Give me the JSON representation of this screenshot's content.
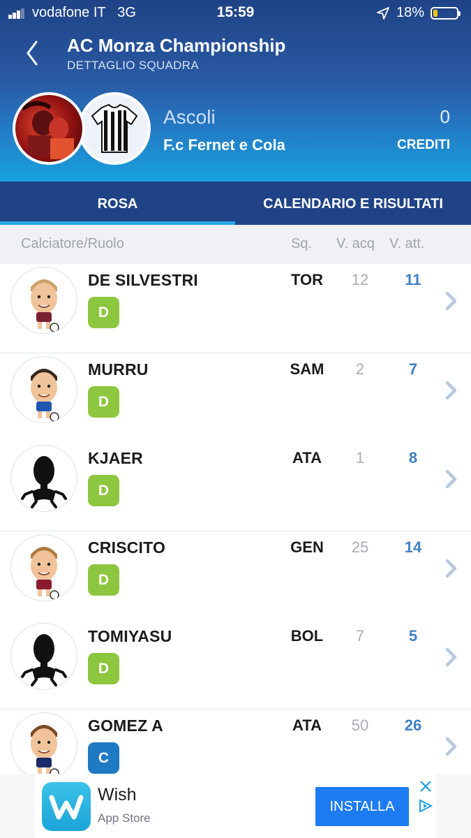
{
  "status_bar": {
    "carrier": "vodafone IT",
    "network": "3G",
    "time": "15:59",
    "battery_percent": "18%",
    "battery_level": 0.18,
    "signal_bars": 3
  },
  "header": {
    "title": "AC Monza Championship",
    "subtitle": "DETTAGLIO SQUADRA"
  },
  "team": {
    "name": "Ascoli",
    "manager": "F.c Fernet e Cola",
    "credits_value": "0",
    "credits_label": "CREDITI"
  },
  "tabs": [
    {
      "label": "ROSA",
      "active": true
    },
    {
      "label": "CALENDARIO E RISULTATI",
      "active": false
    }
  ],
  "columns": {
    "player_role": "Calciatore/Ruolo",
    "team": "Sq.",
    "value_bought": "V. acq",
    "value_current": "V. att."
  },
  "players": [
    {
      "name": "DE SILVESTRI",
      "role": "D",
      "team": "TOR",
      "v_acq": "12",
      "v_att": "11",
      "avatar": "cartoon-player",
      "hair": "#c9a36a",
      "kit": "#7a2231"
    },
    {
      "name": "MURRU",
      "role": "D",
      "team": "SAM",
      "v_acq": "2",
      "v_att": "7",
      "avatar": "cartoon-player",
      "hair": "#3a2a1e",
      "kit": "#1f56b0"
    },
    {
      "name": "KJAER",
      "role": "D",
      "team": "ATA",
      "v_acq": "1",
      "v_att": "8",
      "avatar": "silhouette"
    },
    {
      "name": "CRISCITO",
      "role": "D",
      "team": "GEN",
      "v_acq": "25",
      "v_att": "14",
      "avatar": "cartoon-player",
      "hair": "#b07a3c",
      "kit": "#8a1b2f"
    },
    {
      "name": "TOMIYASU",
      "role": "D",
      "team": "BOL",
      "v_acq": "7",
      "v_att": "5",
      "avatar": "silhouette"
    },
    {
      "name": "GOMEZ A",
      "role": "C",
      "team": "ATA",
      "v_acq": "50",
      "v_att": "26",
      "avatar": "cartoon-player",
      "hair": "#7a4a22",
      "kit": "#1a2a6a"
    }
  ],
  "role_colors": {
    "D": "#8dc63f",
    "C": "#1f7ac4"
  },
  "ad": {
    "app_name": "Wish",
    "store": "App Store",
    "install_label": "INSTALLA"
  },
  "colors": {
    "header_bg": "#1f4386",
    "accent": "#29a9e6",
    "value_current": "#3f7fc4"
  }
}
